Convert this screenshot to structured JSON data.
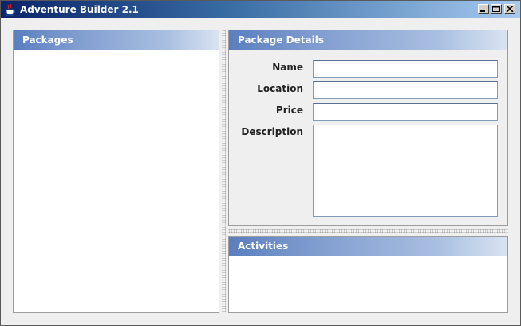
{
  "window": {
    "title": "Adventure Builder 2.1"
  },
  "icons": {
    "app": "java-cup-icon",
    "minimize": "minimize-icon",
    "maximize": "maximize-icon",
    "close": "close-icon"
  },
  "packages": {
    "title": "Packages",
    "items": []
  },
  "details": {
    "title": "Package Details",
    "fields": {
      "name": {
        "label": "Name",
        "value": ""
      },
      "location": {
        "label": "Location",
        "value": ""
      },
      "price": {
        "label": "Price",
        "value": ""
      },
      "description": {
        "label": "Description",
        "value": ""
      }
    }
  },
  "activities": {
    "title": "Activities",
    "items": []
  },
  "colors": {
    "titlebar_dark": "#0a246a",
    "header_blue": "#5a7ebf",
    "field_border": "#7f9db9",
    "background": "#efefef"
  }
}
